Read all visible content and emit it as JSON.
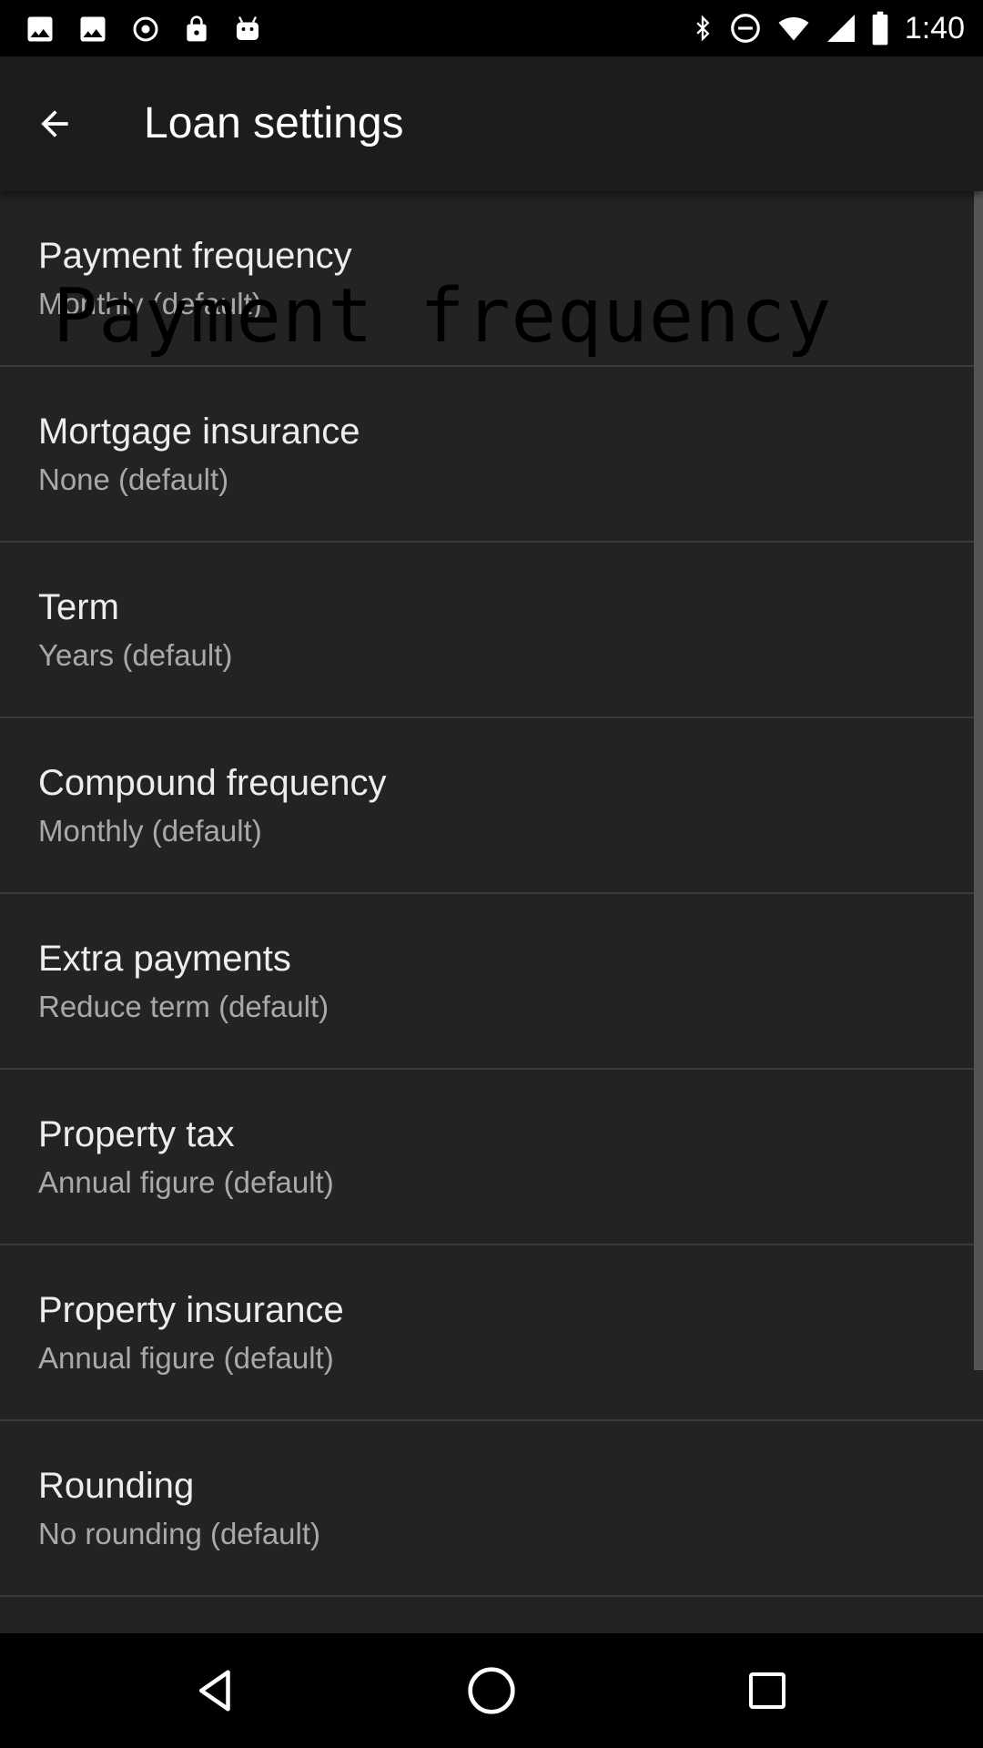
{
  "status_bar": {
    "time": "1:40",
    "left_icons": [
      "image-icon",
      "image-icon",
      "location-icon",
      "lock-icon",
      "android-icon"
    ],
    "right_icons": [
      "bluetooth-icon",
      "do-not-disturb-icon",
      "wifi-icon",
      "signal-icon",
      "battery-icon"
    ]
  },
  "app_bar": {
    "back_icon": "arrow-back-icon",
    "title": "Loan settings"
  },
  "overlay_text": "Payment frequency",
  "settings": [
    {
      "title": "Payment frequency",
      "subtitle": "Monthly (default)"
    },
    {
      "title": "Mortgage insurance",
      "subtitle": "None (default)"
    },
    {
      "title": "Term",
      "subtitle": "Years (default)"
    },
    {
      "title": "Compound frequency",
      "subtitle": "Monthly (default)"
    },
    {
      "title": "Extra payments",
      "subtitle": "Reduce term (default)"
    },
    {
      "title": "Property tax",
      "subtitle": "Annual figure (default)"
    },
    {
      "title": "Property insurance",
      "subtitle": "Annual figure (default)"
    },
    {
      "title": "Rounding",
      "subtitle": "No rounding (default)"
    }
  ],
  "nav_bar": {
    "buttons": [
      "back-triangle-icon",
      "home-circle-icon",
      "recents-square-icon"
    ]
  },
  "colors": {
    "app_bar": "#1c1c1c",
    "list_background": "#232323",
    "divider": "#3a3a3a",
    "title_text": "#ededed",
    "subtitle_text": "#a9a9a9"
  }
}
